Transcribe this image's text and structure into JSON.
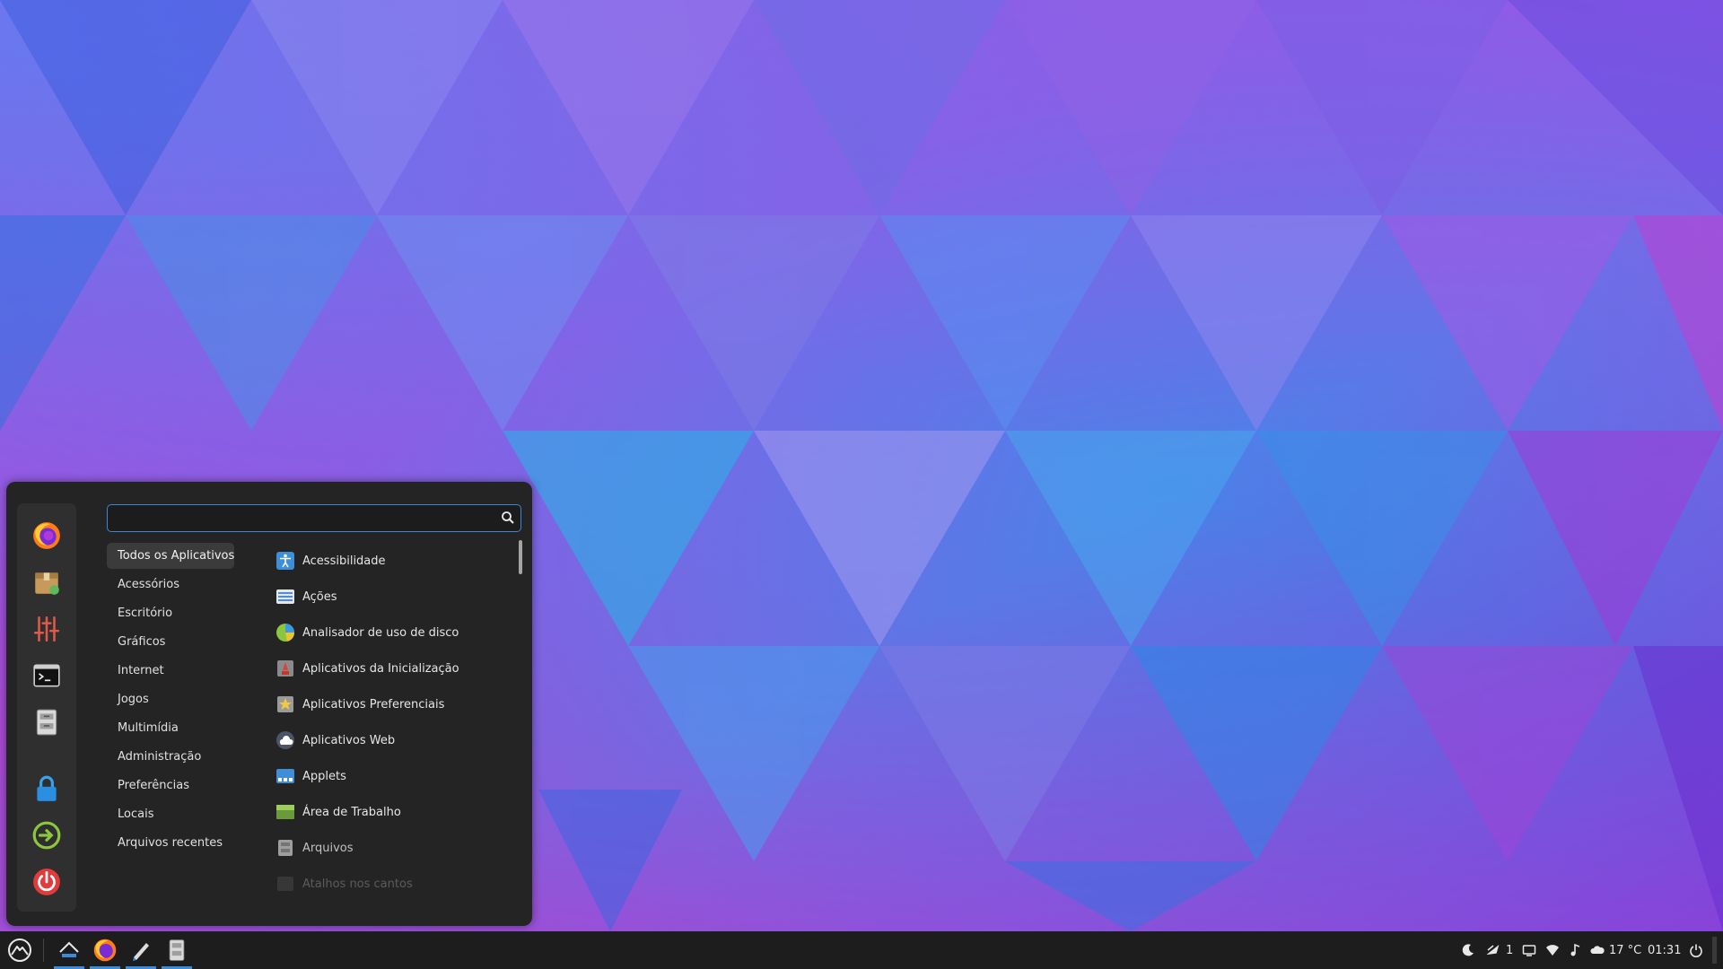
{
  "search": {
    "value": "",
    "placeholder": ""
  },
  "favorites": [
    {
      "icon": "firefox-icon"
    },
    {
      "icon": "software-manager-icon"
    },
    {
      "icon": "settings-sliders-icon"
    },
    {
      "icon": "terminal-icon"
    },
    {
      "icon": "file-cabinet-icon"
    },
    {
      "icon": "lock-screen-icon"
    },
    {
      "icon": "logout-icon"
    },
    {
      "icon": "power-off-icon"
    }
  ],
  "categories": [
    {
      "label": "Todos os Aplicativos",
      "active": true
    },
    {
      "label": "Acessórios"
    },
    {
      "label": "Escritório"
    },
    {
      "label": "Gráficos"
    },
    {
      "label": "Internet"
    },
    {
      "label": "Jogos"
    },
    {
      "label": "Multimídia"
    },
    {
      "label": "Administração"
    },
    {
      "label": "Preferências"
    },
    {
      "label": "Locais"
    },
    {
      "label": "Arquivos recentes"
    }
  ],
  "apps": [
    {
      "label": "Acessibilidade",
      "icon": "accessibility-icon"
    },
    {
      "label": "Ações",
      "icon": "actions-icon"
    },
    {
      "label": "Analisador de uso de disco",
      "icon": "disk-usage-icon"
    },
    {
      "label": "Aplicativos da Inicialização",
      "icon": "startup-apps-icon"
    },
    {
      "label": "Aplicativos Preferenciais",
      "icon": "preferred-apps-icon"
    },
    {
      "label": "Aplicativos Web",
      "icon": "web-apps-icon"
    },
    {
      "label": "Applets",
      "icon": "applets-icon"
    },
    {
      "label": "Área de Trabalho",
      "icon": "desktop-icon"
    },
    {
      "label": "Arquivos",
      "icon": "files-icon"
    },
    {
      "label": "Atalhos nos cantos",
      "icon": "hot-corners-icon"
    }
  ],
  "panel": {
    "notifications_count": "1",
    "temperature": "17 °C",
    "time": "01:31"
  },
  "colors": {
    "accent": "#3b8bdb",
    "menu_bg": "#242424",
    "panel_bg": "#1d1d1d"
  }
}
